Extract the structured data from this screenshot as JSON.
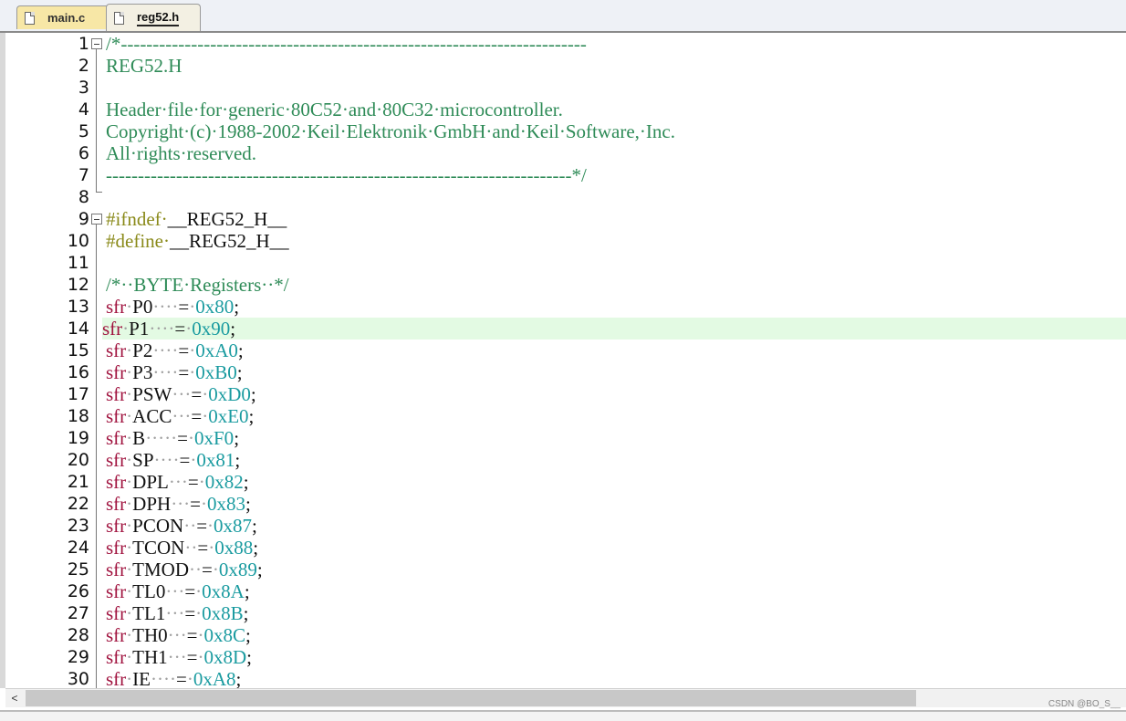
{
  "tabs": [
    {
      "label": "main.c",
      "active": false
    },
    {
      "label": "reg52.h",
      "active": true
    }
  ],
  "editor": {
    "highlighted_line": 14,
    "lines": [
      {
        "n": "1",
        "t": [
          [
            "comment",
            "/*-------------------------------------------------------------------------"
          ]
        ]
      },
      {
        "n": "2",
        "t": [
          [
            "comment",
            "REG52.H"
          ]
        ]
      },
      {
        "n": "3",
        "t": []
      },
      {
        "n": "4",
        "t": [
          [
            "comment",
            "Header·file·for·generic·80C52·and·80C32·microcontroller."
          ]
        ]
      },
      {
        "n": "5",
        "t": [
          [
            "comment",
            "Copyright·(c)·1988-2002·Keil·Elektronik·GmbH·and·Keil·Software,·Inc."
          ]
        ]
      },
      {
        "n": "6",
        "t": [
          [
            "comment",
            "All·rights·reserved."
          ]
        ]
      },
      {
        "n": "7",
        "t": [
          [
            "comment",
            "-------------------------------------------------------------------------*/"
          ]
        ]
      },
      {
        "n": "8",
        "t": []
      },
      {
        "n": "9",
        "t": [
          [
            "pp",
            "#ifndef·"
          ],
          [
            "plain",
            "__REG52_H__"
          ]
        ]
      },
      {
        "n": "10",
        "t": [
          [
            "pp",
            "#define·"
          ],
          [
            "plain",
            "__REG52_H__"
          ]
        ]
      },
      {
        "n": "11",
        "t": []
      },
      {
        "n": "12",
        "t": [
          [
            "comment",
            "/*··BYTE·Registers··*/"
          ]
        ]
      },
      {
        "n": "13",
        "t": [
          [
            "kw",
            "sfr"
          ],
          [
            "dot",
            "·"
          ],
          [
            "plain",
            "P0"
          ],
          [
            "dot",
            "····"
          ],
          [
            "plain",
            "="
          ],
          [
            "dot",
            "·"
          ],
          [
            "num",
            "0x80"
          ],
          [
            "plain",
            ";"
          ]
        ]
      },
      {
        "n": "14",
        "t": [
          [
            "kw",
            "sfr"
          ],
          [
            "dot",
            "·"
          ],
          [
            "plain",
            "P1"
          ],
          [
            "dot",
            "····"
          ],
          [
            "plain",
            "="
          ],
          [
            "dot",
            "·"
          ],
          [
            "num",
            "0x90"
          ],
          [
            "plain",
            ";"
          ]
        ]
      },
      {
        "n": "15",
        "t": [
          [
            "kw",
            "sfr"
          ],
          [
            "dot",
            "·"
          ],
          [
            "plain",
            "P2"
          ],
          [
            "dot",
            "····"
          ],
          [
            "plain",
            "="
          ],
          [
            "dot",
            "·"
          ],
          [
            "num",
            "0xA0"
          ],
          [
            "plain",
            ";"
          ]
        ]
      },
      {
        "n": "16",
        "t": [
          [
            "kw",
            "sfr"
          ],
          [
            "dot",
            "·"
          ],
          [
            "plain",
            "P3"
          ],
          [
            "dot",
            "····"
          ],
          [
            "plain",
            "="
          ],
          [
            "dot",
            "·"
          ],
          [
            "num",
            "0xB0"
          ],
          [
            "plain",
            ";"
          ]
        ]
      },
      {
        "n": "17",
        "t": [
          [
            "kw",
            "sfr"
          ],
          [
            "dot",
            "·"
          ],
          [
            "plain",
            "PSW"
          ],
          [
            "dot",
            "···"
          ],
          [
            "plain",
            "="
          ],
          [
            "dot",
            "·"
          ],
          [
            "num",
            "0xD0"
          ],
          [
            "plain",
            ";"
          ]
        ]
      },
      {
        "n": "18",
        "t": [
          [
            "kw",
            "sfr"
          ],
          [
            "dot",
            "·"
          ],
          [
            "plain",
            "ACC"
          ],
          [
            "dot",
            "···"
          ],
          [
            "plain",
            "="
          ],
          [
            "dot",
            "·"
          ],
          [
            "num",
            "0xE0"
          ],
          [
            "plain",
            ";"
          ]
        ]
      },
      {
        "n": "19",
        "t": [
          [
            "kw",
            "sfr"
          ],
          [
            "dot",
            "·"
          ],
          [
            "plain",
            "B"
          ],
          [
            "dot",
            "·····"
          ],
          [
            "plain",
            "="
          ],
          [
            "dot",
            "·"
          ],
          [
            "num",
            "0xF0"
          ],
          [
            "plain",
            ";"
          ]
        ]
      },
      {
        "n": "20",
        "t": [
          [
            "kw",
            "sfr"
          ],
          [
            "dot",
            "·"
          ],
          [
            "plain",
            "SP"
          ],
          [
            "dot",
            "····"
          ],
          [
            "plain",
            "="
          ],
          [
            "dot",
            "·"
          ],
          [
            "num",
            "0x81"
          ],
          [
            "plain",
            ";"
          ]
        ]
      },
      {
        "n": "21",
        "t": [
          [
            "kw",
            "sfr"
          ],
          [
            "dot",
            "·"
          ],
          [
            "plain",
            "DPL"
          ],
          [
            "dot",
            "···"
          ],
          [
            "plain",
            "="
          ],
          [
            "dot",
            "·"
          ],
          [
            "num",
            "0x82"
          ],
          [
            "plain",
            ";"
          ]
        ]
      },
      {
        "n": "22",
        "t": [
          [
            "kw",
            "sfr"
          ],
          [
            "dot",
            "·"
          ],
          [
            "plain",
            "DPH"
          ],
          [
            "dot",
            "···"
          ],
          [
            "plain",
            "="
          ],
          [
            "dot",
            "·"
          ],
          [
            "num",
            "0x83"
          ],
          [
            "plain",
            ";"
          ]
        ]
      },
      {
        "n": "23",
        "t": [
          [
            "kw",
            "sfr"
          ],
          [
            "dot",
            "·"
          ],
          [
            "plain",
            "PCON"
          ],
          [
            "dot",
            "··"
          ],
          [
            "plain",
            "="
          ],
          [
            "dot",
            "·"
          ],
          [
            "num",
            "0x87"
          ],
          [
            "plain",
            ";"
          ]
        ]
      },
      {
        "n": "24",
        "t": [
          [
            "kw",
            "sfr"
          ],
          [
            "dot",
            "·"
          ],
          [
            "plain",
            "TCON"
          ],
          [
            "dot",
            "··"
          ],
          [
            "plain",
            "="
          ],
          [
            "dot",
            "·"
          ],
          [
            "num",
            "0x88"
          ],
          [
            "plain",
            ";"
          ]
        ]
      },
      {
        "n": "25",
        "t": [
          [
            "kw",
            "sfr"
          ],
          [
            "dot",
            "·"
          ],
          [
            "plain",
            "TMOD"
          ],
          [
            "dot",
            "··"
          ],
          [
            "plain",
            "="
          ],
          [
            "dot",
            "·"
          ],
          [
            "num",
            "0x89"
          ],
          [
            "plain",
            ";"
          ]
        ]
      },
      {
        "n": "26",
        "t": [
          [
            "kw",
            "sfr"
          ],
          [
            "dot",
            "·"
          ],
          [
            "plain",
            "TL0"
          ],
          [
            "dot",
            "···"
          ],
          [
            "plain",
            "="
          ],
          [
            "dot",
            "·"
          ],
          [
            "num",
            "0x8A"
          ],
          [
            "plain",
            ";"
          ]
        ]
      },
      {
        "n": "27",
        "t": [
          [
            "kw",
            "sfr"
          ],
          [
            "dot",
            "·"
          ],
          [
            "plain",
            "TL1"
          ],
          [
            "dot",
            "···"
          ],
          [
            "plain",
            "="
          ],
          [
            "dot",
            "·"
          ],
          [
            "num",
            "0x8B"
          ],
          [
            "plain",
            ";"
          ]
        ]
      },
      {
        "n": "28",
        "t": [
          [
            "kw",
            "sfr"
          ],
          [
            "dot",
            "·"
          ],
          [
            "plain",
            "TH0"
          ],
          [
            "dot",
            "···"
          ],
          [
            "plain",
            "="
          ],
          [
            "dot",
            "·"
          ],
          [
            "num",
            "0x8C"
          ],
          [
            "plain",
            ";"
          ]
        ]
      },
      {
        "n": "29",
        "t": [
          [
            "kw",
            "sfr"
          ],
          [
            "dot",
            "·"
          ],
          [
            "plain",
            "TH1"
          ],
          [
            "dot",
            "···"
          ],
          [
            "plain",
            "="
          ],
          [
            "dot",
            "·"
          ],
          [
            "num",
            "0x8D"
          ],
          [
            "plain",
            ";"
          ]
        ]
      },
      {
        "n": "30",
        "t": [
          [
            "kw",
            "sfr"
          ],
          [
            "dot",
            "·"
          ],
          [
            "plain",
            "IE"
          ],
          [
            "dot",
            "····"
          ],
          [
            "plain",
            "="
          ],
          [
            "dot",
            "·"
          ],
          [
            "num",
            "0xA8"
          ],
          [
            "plain",
            ";"
          ]
        ]
      }
    ]
  },
  "scrollbar": {
    "left_arrow": "<"
  },
  "watermark": "CSDN @BO_S__",
  "colors": {
    "comment": "#2e8b57",
    "preprocessor": "#8a8a1a",
    "keyword": "#a0123e",
    "number": "#1a9ba0",
    "highlight": "#e3fae3"
  }
}
